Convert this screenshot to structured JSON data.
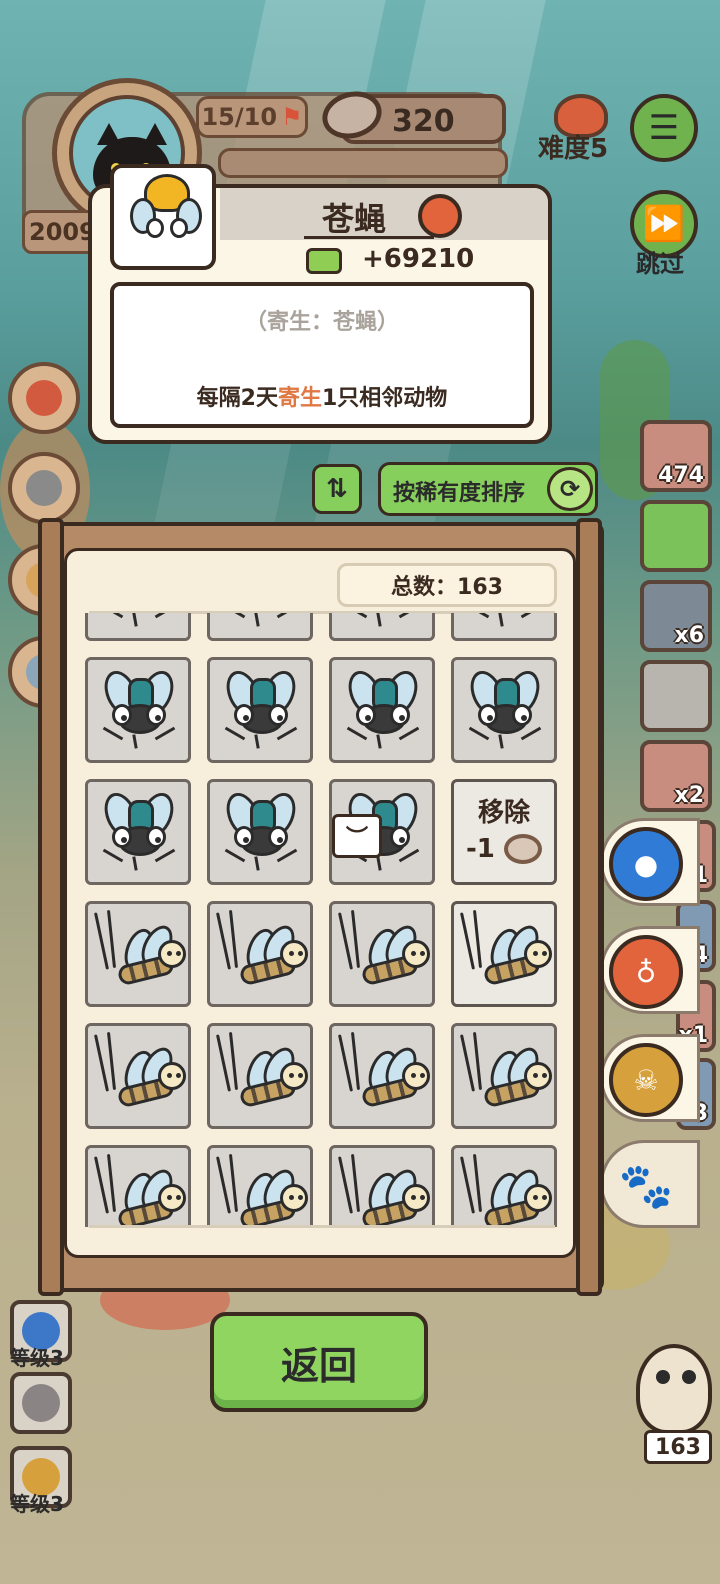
{
  "hud": {
    "capacity": "15/10",
    "money": "320",
    "difficulty": "难度5",
    "day": "2009",
    "skip_label": "跳过",
    "menu_icon": "list-menu-icon",
    "skip_icon": "fast-forward-icon"
  },
  "creature_card": {
    "name": "苍蝇",
    "value": "+69210",
    "trait": "（寄生：苍蝇）",
    "description_before": "每隔2天",
    "description_highlight": "寄生",
    "description_after": "1只相邻动物",
    "highlight_color": "#e07843"
  },
  "sort": {
    "label": "按稀有度排序",
    "toggle_icon": "sort-toggle-icon",
    "refresh_icon": "refresh-cycle-icon"
  },
  "collection": {
    "total": "总数：163",
    "remove_label": "移除",
    "remove_cost": "-1",
    "tooltip": "︶",
    "rows": [
      [
        "fly",
        "fly",
        "fly",
        "fly"
      ],
      [
        "fly",
        "fly",
        "fly",
        "fly"
      ],
      [
        "fly",
        "fly",
        "fly",
        "remove"
      ],
      [
        "mosquito",
        "mosquito",
        "mosquito",
        "mosquito"
      ],
      [
        "mosquito",
        "mosquito",
        "mosquito",
        "mosquito"
      ],
      [
        "mosquito",
        "mosquito",
        "mosquito",
        "mosquito"
      ]
    ]
  },
  "back_button": "返回",
  "side_shelf_counts": [
    "474",
    "x6",
    "x2",
    "x1",
    "x4",
    "x1",
    "x3"
  ],
  "levels": [
    "等级3",
    "等级3"
  ],
  "bird_count": "163",
  "colors": {
    "button_green": "#8fd560",
    "accent_orange": "#e07843",
    "panel_wood": "#b58a67",
    "card_cream": "#fcf6e6"
  }
}
